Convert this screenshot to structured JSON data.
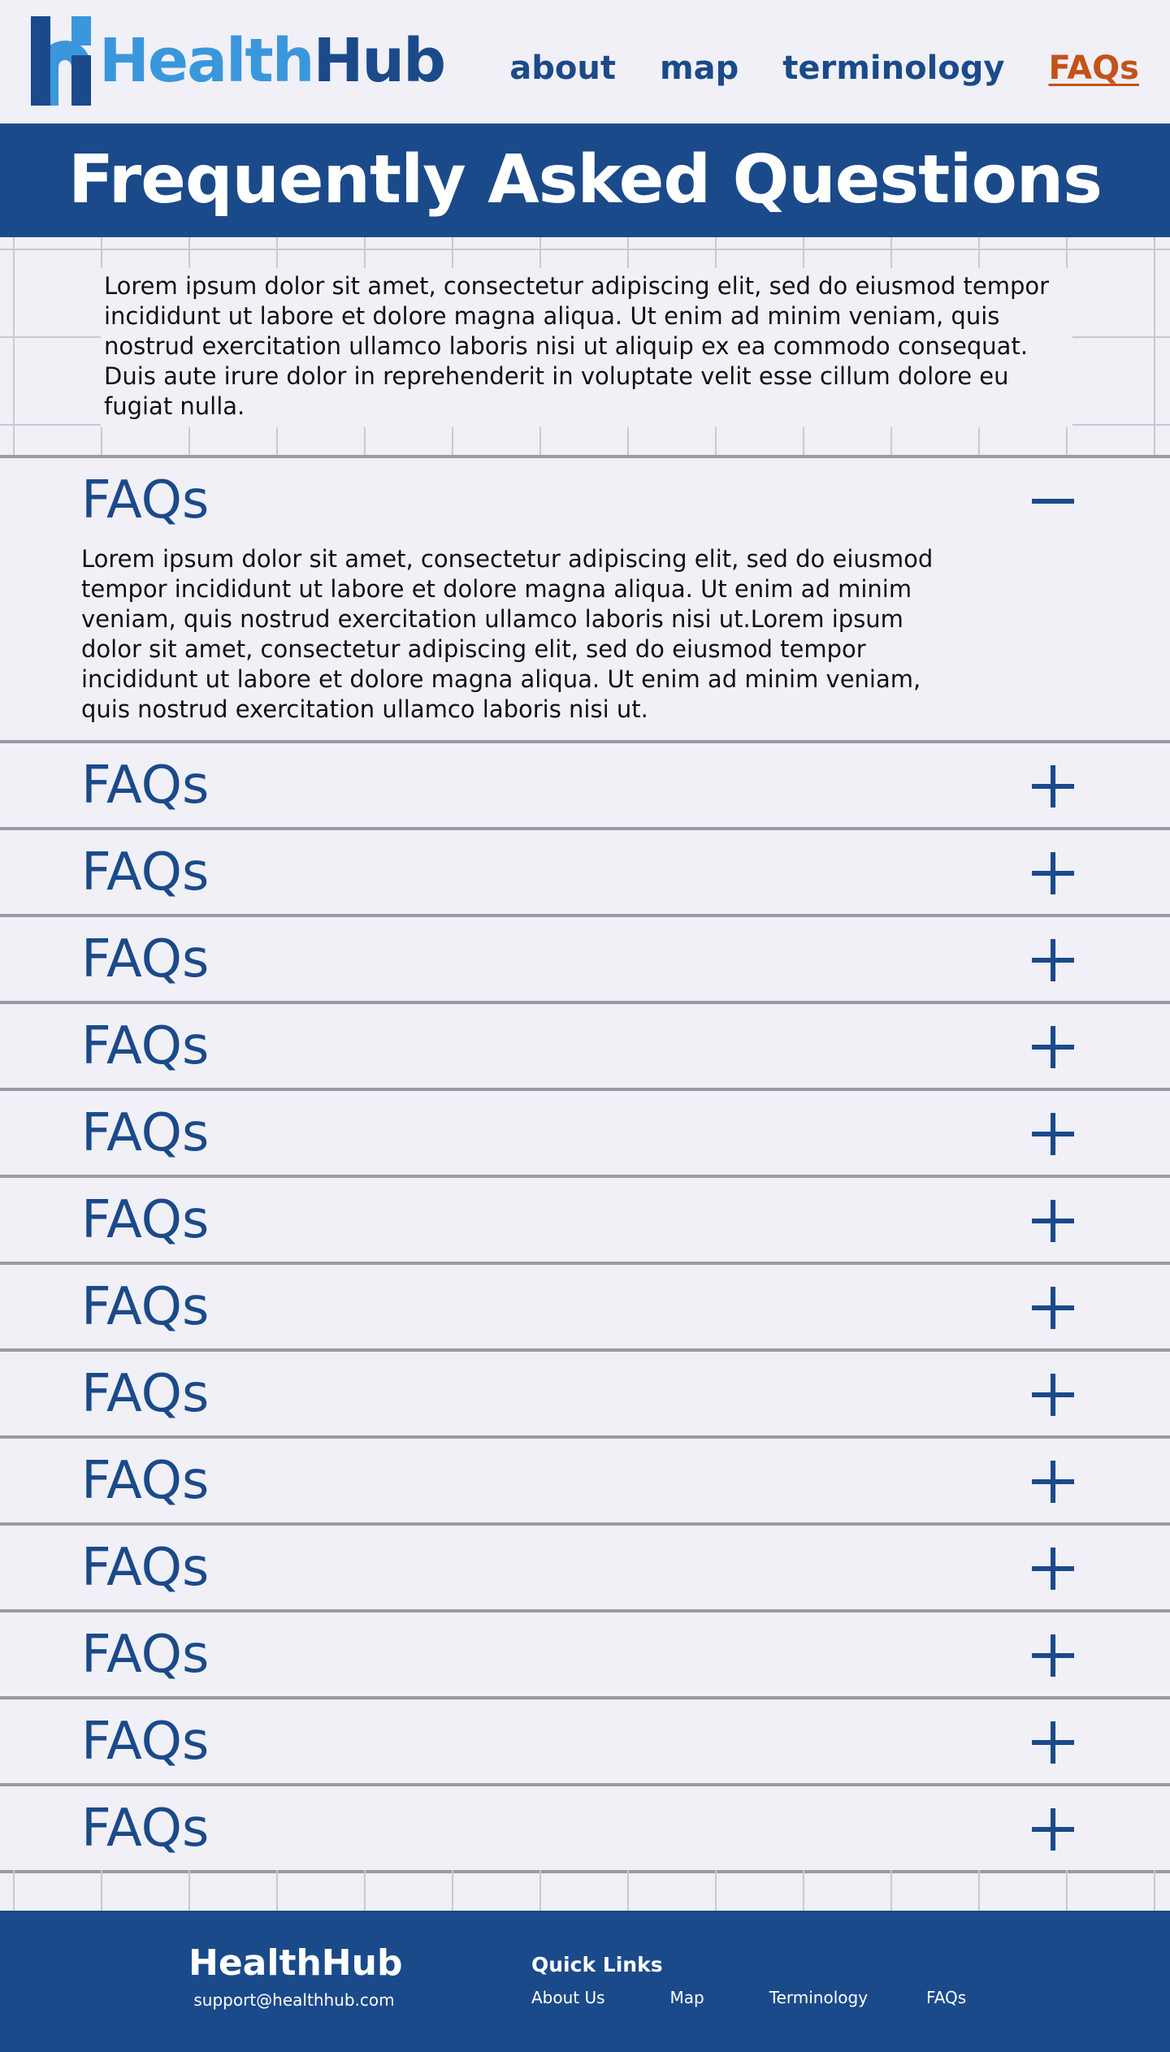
{
  "header": {
    "logo_part1": "Health",
    "logo_part2": "Hub",
    "nav": [
      {
        "label": "about",
        "active": false
      },
      {
        "label": "map",
        "active": false
      },
      {
        "label": "terminology",
        "active": false
      },
      {
        "label": "FAQs",
        "active": true
      }
    ]
  },
  "banner": {
    "title": "Frequently Asked Questions"
  },
  "intro": {
    "text": "Lorem ipsum dolor sit amet, consectetur adipiscing elit, sed do eiusmod tempor incididunt ut labore et dolore magna aliqua. Ut enim ad minim veniam, quis nostrud exercitation ullamco laboris nisi ut aliquip ex ea commodo consequat. Duis aute irure dolor in reprehenderit in voluptate velit esse cillum dolore eu fugiat nulla."
  },
  "faqs": [
    {
      "question": "FAQs",
      "open": true,
      "answer": "Lorem ipsum dolor sit amet, consectetur adipiscing elit, sed do eiusmod tempor incididunt ut labore et dolore magna aliqua. Ut enim ad minim veniam, quis nostrud exercitation ullamco laboris nisi ut.Lorem ipsum dolor sit amet, consectetur adipiscing elit, sed do eiusmod tempor incididunt ut labore et dolore magna aliqua. Ut enim ad minim veniam, quis nostrud exercitation ullamco laboris nisi ut."
    },
    {
      "question": "FAQs",
      "open": false
    },
    {
      "question": "FAQs",
      "open": false
    },
    {
      "question": "FAQs",
      "open": false
    },
    {
      "question": "FAQs",
      "open": false
    },
    {
      "question": "FAQs",
      "open": false
    },
    {
      "question": "FAQs",
      "open": false
    },
    {
      "question": "FAQs",
      "open": false
    },
    {
      "question": "FAQs",
      "open": false
    },
    {
      "question": "FAQs",
      "open": false
    },
    {
      "question": "FAQs",
      "open": false
    },
    {
      "question": "FAQs",
      "open": false
    },
    {
      "question": "FAQs",
      "open": false
    },
    {
      "question": "FAQs",
      "open": false
    }
  ],
  "footer": {
    "brand": "HealthHub",
    "email": "support@healthhub.com",
    "quick_links_title": "Quick Links",
    "links": [
      "About Us",
      "Map",
      "Terminology",
      "FAQs"
    ]
  },
  "colors": {
    "primary": "#1b4a8a",
    "accent": "#3a97db",
    "active_nav": "#c4521a",
    "background": "#f0f0f6"
  },
  "icons": {
    "expand": "plus-icon",
    "collapse": "minus-icon"
  }
}
